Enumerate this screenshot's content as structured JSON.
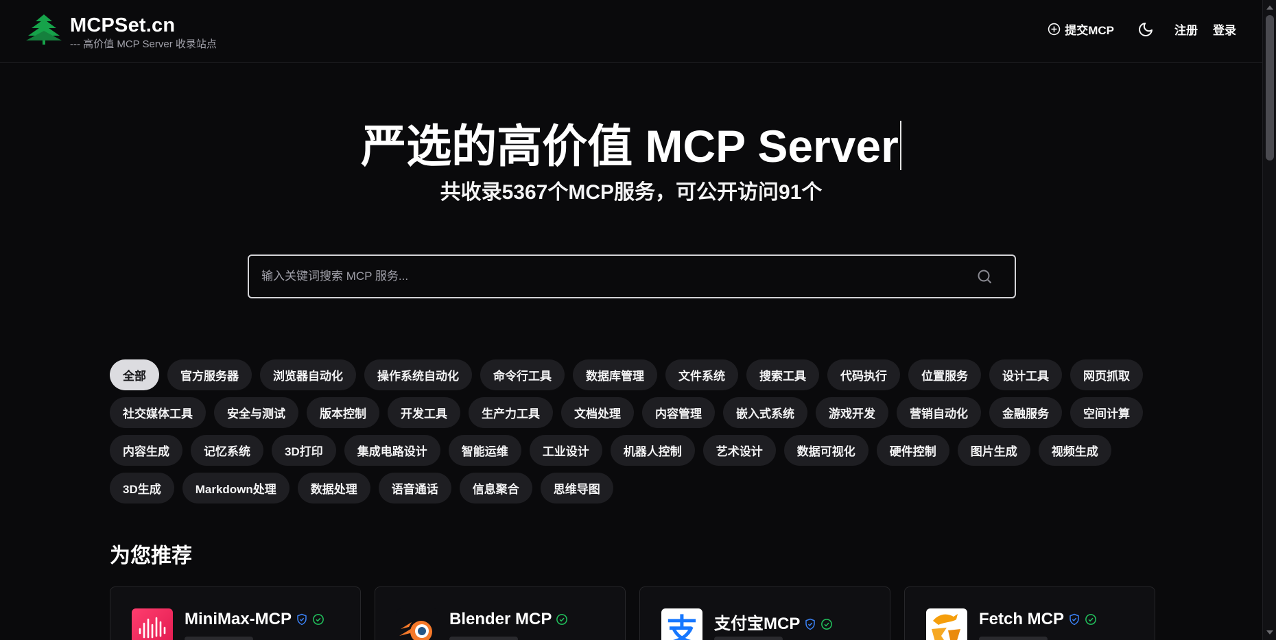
{
  "brand": {
    "name": "MCPSet.cn",
    "tagline": "--- 高价值 MCP Server 收录站点"
  },
  "nav": {
    "submit_label": "提交MCP",
    "register_label": "注册",
    "login_label": "登录"
  },
  "hero": {
    "title": "严选的高价值 MCP Server",
    "subtitle": "共收录5367个MCP服务，可公开访问91个"
  },
  "search": {
    "placeholder": "输入关键词搜索 MCP 服务..."
  },
  "categories": [
    "全部",
    "官方服务器",
    "浏览器自动化",
    "操作系统自动化",
    "命令行工具",
    "数据库管理",
    "文件系统",
    "搜索工具",
    "代码执行",
    "位置服务",
    "设计工具",
    "网页抓取",
    "社交媒体工具",
    "安全与测试",
    "版本控制",
    "开发工具",
    "生产力工具",
    "文档处理",
    "内容管理",
    "嵌入式系统",
    "游戏开发",
    "营销自动化",
    "金融服务",
    "空间计算",
    "内容生成",
    "记忆系统",
    "3D打印",
    "集成电路设计",
    "智能运维",
    "工业设计",
    "机器人控制",
    "艺术设计",
    "数据可视化",
    "硬件控制",
    "图片生成",
    "视频生成",
    "3D生成",
    "Markdown处理",
    "数据处理",
    "语音通话",
    "信息聚合",
    "思维导图"
  ],
  "active_category": "全部",
  "recommend": {
    "title": "为您推荐",
    "cards": [
      {
        "name": "MiniMax-MCP",
        "verified": true,
        "official": true,
        "icon": "minimax-logo-icon"
      },
      {
        "name": "Blender MCP",
        "verified": false,
        "official": true,
        "icon": "blender-logo-icon"
      },
      {
        "name": "支付宝MCP",
        "verified": true,
        "official": true,
        "icon": "alipay-logo-icon"
      },
      {
        "name": "Fetch MCP",
        "verified": true,
        "official": true,
        "icon": "fetch-logo-icon"
      }
    ]
  },
  "colors": {
    "background": "#0a0a0c",
    "chip": "#1e1e22",
    "chip_active": "#dcdce0",
    "logo_green": "#16a34a",
    "verified_blue": "#3b82f6",
    "official_green": "#22c55e"
  }
}
